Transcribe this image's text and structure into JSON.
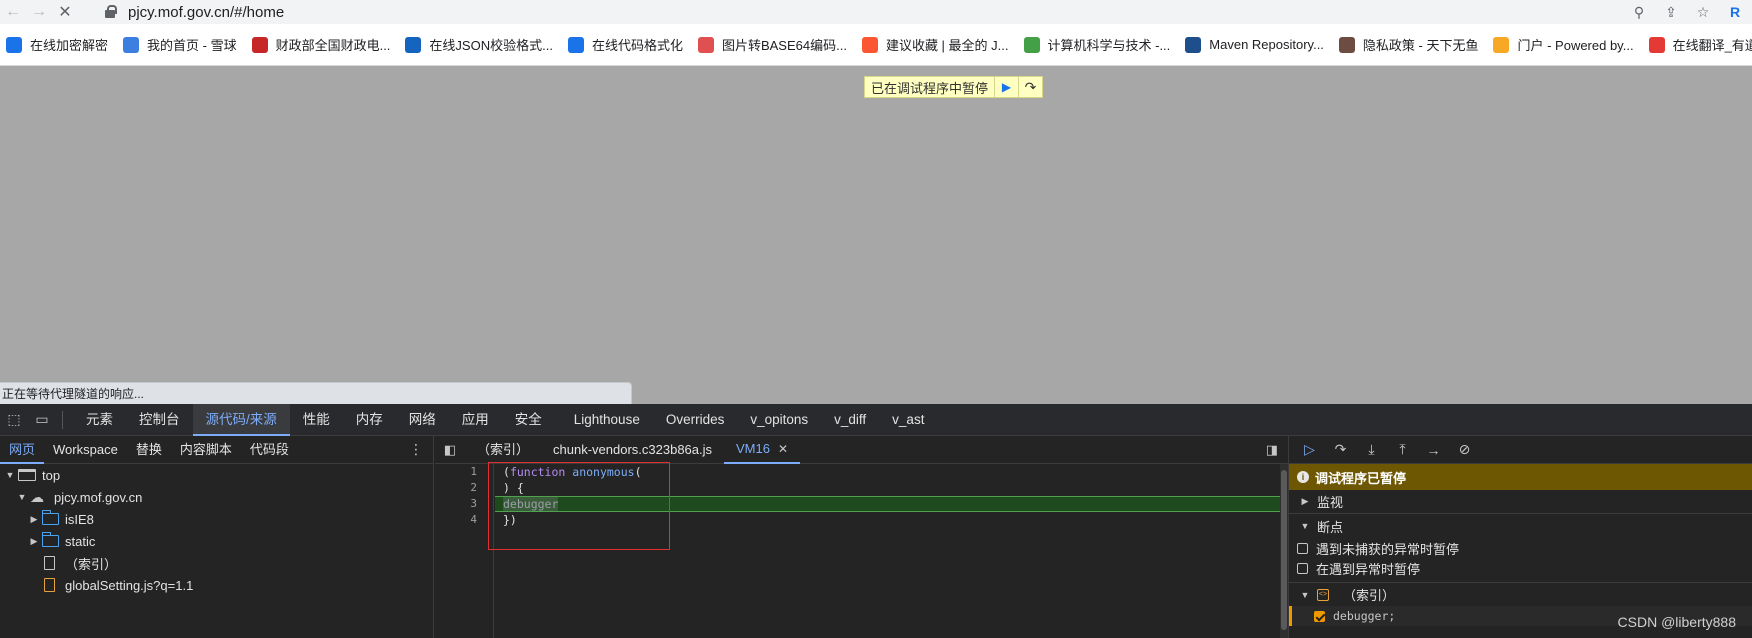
{
  "browser": {
    "url_host": "pjcy.mof.gov.cn",
    "url_path": "/#/home"
  },
  "bookmarks": [
    {
      "label": "在线加密解密",
      "icon": "c-logo-icon",
      "color": "#1a73e8"
    },
    {
      "label": "我的首页 - 雪球",
      "icon": "snowball-icon",
      "color": "#3d7fe0"
    },
    {
      "label": "财政部全国财政电...",
      "icon": "mof-icon",
      "color": "#c62828"
    },
    {
      "label": "在线JSON校验格式...",
      "icon": "bejson-icon",
      "color": "#1565c0"
    },
    {
      "label": "在线代码格式化",
      "icon": "c-logo-icon",
      "color": "#1a73e8"
    },
    {
      "label": "图片转BASE64编码...",
      "icon": "image-icon",
      "color": "#e05050"
    },
    {
      "label": "建议收藏 | 最全的 J...",
      "icon": "csdn-icon",
      "color": "#fc5531"
    },
    {
      "label": "计算机科学与技术 -...",
      "icon": "leaf-icon",
      "color": "#43a047"
    },
    {
      "label": "Maven Repository...",
      "icon": "mvn-icon",
      "color": "#1f4e8c"
    },
    {
      "label": "隐私政策 - 天下无鱼",
      "icon": "avatar-icon",
      "color": "#6d4c41"
    },
    {
      "label": "门户 - Powered by...",
      "icon": "trophy-icon",
      "color": "#f9a825"
    },
    {
      "label": "在线翻译_有道",
      "icon": "youdao-icon",
      "color": "#e53935"
    }
  ],
  "page": {
    "paused_banner": "已在调试程序中暂停",
    "status_text": "正在等待代理隧道的响应..."
  },
  "devtools": {
    "tabs": [
      "元素",
      "控制台",
      "源代码/来源",
      "性能",
      "内存",
      "网络",
      "应用",
      "安全",
      "Lighthouse",
      "Overrides",
      "v_opitons",
      "v_diff",
      "v_ast"
    ],
    "active_tab": "源代码/来源",
    "nav_tabs": [
      "网页",
      "Workspace",
      "替换",
      "内容脚本",
      "代码段"
    ],
    "tree": {
      "top": "top",
      "domain": "pjcy.mof.gov.cn",
      "folders": [
        "isIE8",
        "static"
      ],
      "index": "（索引）",
      "file": "globalSetting.js?q=1.1"
    },
    "editor_tabs": [
      "（索引）",
      "chunk-vendors.c323b86a.js",
      "VM16"
    ],
    "code": {
      "line_numbers": [
        "1",
        "2",
        "3",
        "4"
      ],
      "l1_paren": "(",
      "l1_kw": "function",
      "l1_fn": "anonymous",
      "l1_end": "(",
      "l2": ") {",
      "l3": "debugger",
      "l4": "})"
    },
    "debugger": {
      "paused_title": "调试程序已暂停",
      "watch": "监视",
      "breakpoints": "断点",
      "uncaught_label": "遇到未捕获的异常时暂停",
      "caught_label": "在遇到异常时暂停",
      "bp_file": "（索引）",
      "bp_line": "debugger;"
    }
  },
  "watermark": "CSDN @liberty888"
}
